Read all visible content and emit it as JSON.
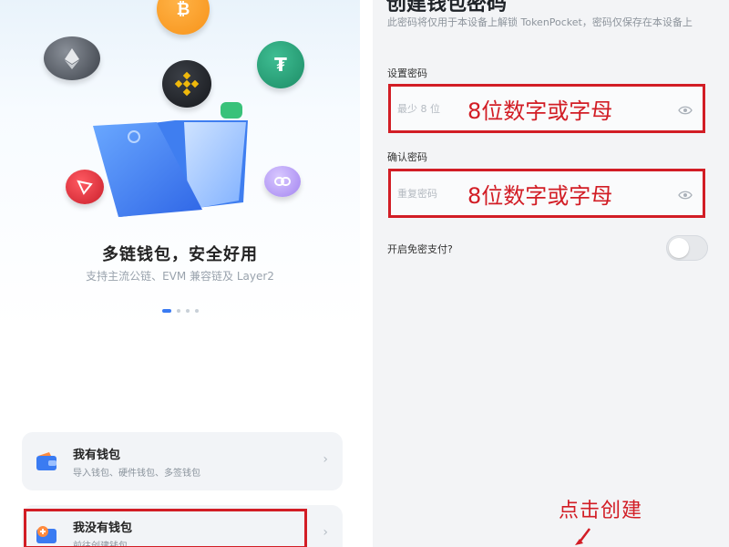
{
  "left": {
    "tagline": "多链钱包，安全好用",
    "subline": "支持主流公链、EVM 兼容链及 Layer2",
    "carousel": {
      "count": 4,
      "active": 0
    },
    "cards": [
      {
        "title": "我有钱包",
        "desc": "导入钱包、硬件钱包、多签钱包",
        "chevron": "›"
      },
      {
        "title": "我没有钱包",
        "desc": "前往创建钱包",
        "chevron": "›"
      }
    ]
  },
  "right": {
    "title": "创建钱包密码",
    "note": "此密码将仅用于本设备上解锁 TokenPocket，密码仅保存在本设备上",
    "set_password": {
      "label": "设置密码",
      "placeholder": "最少 8 位",
      "annotation": "8位数字或字母"
    },
    "confirm_password": {
      "label": "确认密码",
      "placeholder": "重复密码",
      "annotation": "8位数字或字母"
    },
    "toggle": {
      "label": "开启免密支付?",
      "state": "off"
    },
    "annotation_bottom": "点击创建"
  },
  "colors": {
    "accent": "#3a7bf2",
    "annotation_red": "#d21d25",
    "bnb": "#f0b90b",
    "usdt_green": "#26a17b"
  },
  "icons": [
    "bitcoin-coin-icon",
    "ethereum-coin-icon",
    "bnb-coin-icon",
    "usdt-coin-icon",
    "tron-coin-icon",
    "chainlink-coin-icon",
    "folder-wallet-icon",
    "eye-icon",
    "chevron-right-icon",
    "wallet-icon",
    "add-wallet-icon"
  ]
}
